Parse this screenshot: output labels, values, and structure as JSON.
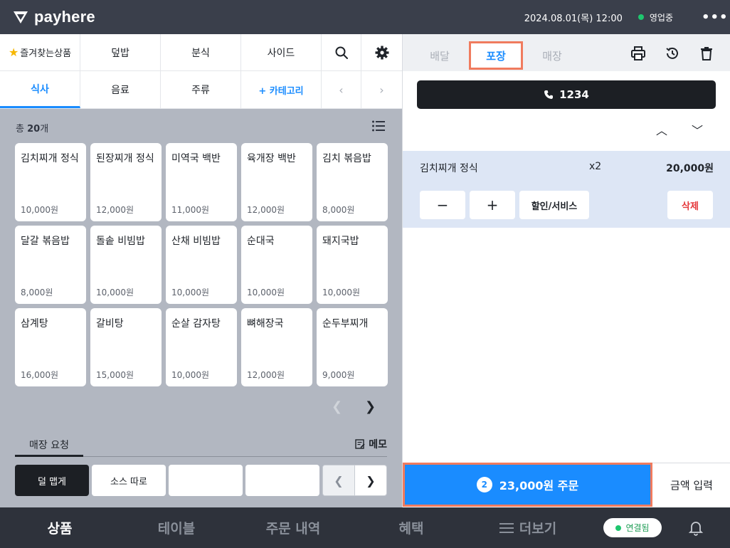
{
  "topbar": {
    "brand": "payhere",
    "datetime": "2024.08.01(목) 12:00",
    "status": "영업중",
    "more_icon": "more-dots-icon"
  },
  "categories": {
    "favorites": "즐겨찾는상품",
    "row1": [
      "덮밥",
      "분식",
      "사이드"
    ],
    "row2": [
      "식사",
      "음료",
      "주류"
    ],
    "add": "+ 카테고리",
    "active": "식사"
  },
  "products": {
    "total_prefix": "총 ",
    "total_count": "20",
    "total_suffix": "개",
    "items": [
      {
        "name": "김치찌개 정식",
        "price": "10,000원"
      },
      {
        "name": "된장찌개 정식",
        "price": "12,000원"
      },
      {
        "name": "미역국 백반",
        "price": "11,000원"
      },
      {
        "name": "육개장 백반",
        "price": "12,000원"
      },
      {
        "name": "김치 볶음밥",
        "price": "8,000원"
      },
      {
        "name": "달갈 볶음밥",
        "price": "8,000원"
      },
      {
        "name": "돌솥 비빔밥",
        "price": "10,000원"
      },
      {
        "name": "산채 비빔밥",
        "price": "10,000원"
      },
      {
        "name": "순대국",
        "price": "10,000원"
      },
      {
        "name": "돼지국밥",
        "price": "10,000원"
      },
      {
        "name": "삼계탕",
        "price": "16,000원"
      },
      {
        "name": "갈비탕",
        "price": "15,000원"
      },
      {
        "name": "순살 감자탕",
        "price": "10,000원"
      },
      {
        "name": "뼈해장국",
        "price": "12,000원"
      },
      {
        "name": "순두부찌개",
        "price": "9,000원"
      }
    ]
  },
  "requests": {
    "tab": "매장 요청",
    "memo": "메모",
    "buttons": [
      "덜 맵게",
      "소스 따로",
      "",
      ""
    ]
  },
  "order": {
    "tabs": [
      "배달",
      "포장",
      "매장"
    ],
    "active_tab": "포장",
    "phone": "1234",
    "item": {
      "name": "김치찌개 정식",
      "qty": "x2",
      "price": "20,000원"
    },
    "minus": "−",
    "plus": "+",
    "discount": "할인/서비스",
    "delete": "삭제",
    "count": "2",
    "order_label": "23,000원 주문",
    "amount_input": "금액 입력"
  },
  "bottom_nav": {
    "items": [
      "상품",
      "테이블",
      "주문 내역",
      "혜택",
      "더보기"
    ],
    "active": "상품",
    "connected": "연결됨"
  },
  "colors": {
    "accent": "#1a8cff",
    "highlight": "#f07b5e",
    "topbar": "#3a3f4b",
    "status_green": "#1ec66e",
    "delete_red": "#e5383b"
  }
}
